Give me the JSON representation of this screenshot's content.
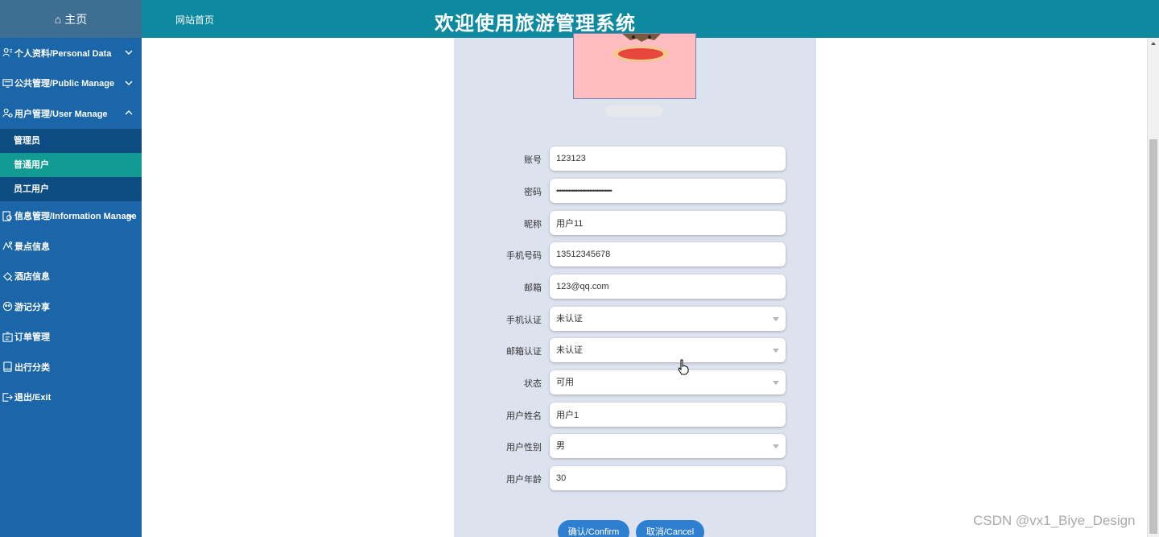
{
  "header": {
    "home_label": "主页",
    "site_link": "网站首页",
    "title": "欢迎使用旅游管理系统"
  },
  "sidebar": {
    "items": [
      {
        "label": "个人资料/Personal Data",
        "icon": "user-card-icon",
        "chevron": "down"
      },
      {
        "label": "公共管理/Public Manage",
        "icon": "monitor-icon",
        "chevron": "down"
      },
      {
        "label": "用户管理/User Manage",
        "icon": "users-icon",
        "chevron": "up"
      },
      {
        "label": "信息管理/Information Manage",
        "icon": "gear-doc-icon",
        "chevron": "down"
      },
      {
        "label": "景点信息",
        "icon": "scenic-icon"
      },
      {
        "label": "酒店信息",
        "icon": "hotel-icon"
      },
      {
        "label": "游记分享",
        "icon": "share-icon"
      },
      {
        "label": "订单管理",
        "icon": "order-icon"
      },
      {
        "label": "出行分类",
        "icon": "category-icon"
      },
      {
        "label": "退出/Exit",
        "icon": "exit-icon"
      }
    ],
    "submenu": [
      "管理员",
      "普通用户",
      "员工用户"
    ],
    "active_submenu": "普通用户"
  },
  "form": {
    "fields": [
      {
        "label": "账号",
        "value": "123123",
        "type": "text"
      },
      {
        "label": "密码",
        "value": "••••••••••••••••••••••••••••••••",
        "type": "password"
      },
      {
        "label": "昵称",
        "value": "用户11",
        "type": "text"
      },
      {
        "label": "手机号码",
        "value": "13512345678",
        "type": "text"
      },
      {
        "label": "邮箱",
        "value": "123@qq.com",
        "type": "text"
      },
      {
        "label": "手机认证",
        "value": "未认证",
        "type": "select"
      },
      {
        "label": "邮箱认证",
        "value": "未认证",
        "type": "select"
      },
      {
        "label": "状态",
        "value": "可用",
        "type": "select"
      },
      {
        "label": "用户姓名",
        "value": "用户1",
        "type": "text"
      },
      {
        "label": "用户性别",
        "value": "男",
        "type": "select"
      },
      {
        "label": "用户年龄",
        "value": "30",
        "type": "text"
      }
    ],
    "confirm_label": "确认/Confirm",
    "cancel_label": "取消/Cancel"
  },
  "colors": {
    "topbar": "#0e8aa0",
    "sidebar": "#1a66a8",
    "submenu": "#0d4c82",
    "active": "#119b93",
    "panel": "#dde2ef",
    "button": "#2f7fd0"
  },
  "watermark": "CSDN @vx1_Biye_Design"
}
